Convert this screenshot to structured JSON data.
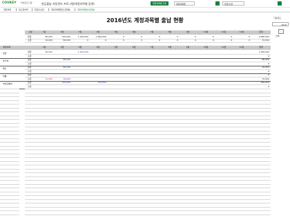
{
  "app": {
    "logo": "COUKEY",
    "logo_sub": "엑셀프로그램",
    "title": "현금출납 자동관리 프로그램(계정과목별 집계)",
    "green_button": "계정과목별 조회",
    "select_label": "계정과목명",
    "input_value": "입금/출금",
    "accent": "#1d7f3a"
  },
  "tabs": [
    {
      "label": "계정과목"
    },
    {
      "label": "입출금내역"
    },
    {
      "label": "현금출납장"
    },
    {
      "label": "계정과목별입출금현황"
    },
    {
      "label": "계정과목별출납현황"
    }
  ],
  "sidebar": {
    "label": "기준년도",
    "year": "2016",
    "icon_label": "인쇄"
  },
  "report": {
    "title": "2016년도 계정과목별 출납 현황",
    "month_header": "구분",
    "months": [
      "1월",
      "2월",
      "3월",
      "4월",
      "5월",
      "6월",
      "7월",
      "8월",
      "9월",
      "10월",
      "11월",
      "12월",
      "합계"
    ],
    "summary_rows": [
      {
        "label": "입금",
        "values": [
          "80,000",
          "150,000",
          "1,100,000",
          "1,900,000",
          "0",
          "0",
          "0",
          "0",
          "0",
          "0",
          "0",
          "0",
          "4,980,000"
        ]
      },
      {
        "label": "출금",
        "values": [
          "10,000",
          "80,000",
          "0",
          "0",
          "0",
          "0",
          "0",
          "0",
          "0",
          "0",
          "0",
          "0",
          "70,000"
        ]
      }
    ],
    "account_header": "계정과목",
    "accounts": [
      {
        "name": "입금",
        "in": [
          "80,000",
          "",
          "1,100,000",
          "",
          "",
          "",
          "",
          "",
          "",
          "",
          "",
          "",
          "1,000,000"
        ],
        "out": [
          "",
          "",
          "",
          "",
          "",
          "",
          "",
          "",
          "",
          "",
          "",
          "",
          "0"
        ]
      },
      {
        "name": "부가세",
        "in": [
          "",
          "80,000",
          "",
          "",
          "",
          "",
          "",
          "",
          "",
          "",
          "",
          "",
          "80,000"
        ],
        "out": [
          "",
          "",
          "",
          "",
          "",
          "",
          "",
          "",
          "",
          "",
          "",
          "",
          "0"
        ]
      },
      {
        "name": "매출",
        "in": [
          "",
          "80,000",
          "",
          "",
          "",
          "",
          "",
          "",
          "",
          "",
          "",
          "",
          "10,000"
        ],
        "out": [
          "",
          "",
          "",
          "",
          "",
          "",
          "",
          "",
          "",
          "",
          "",
          "",
          "0"
        ]
      },
      {
        "name": "비품",
        "in": [
          "",
          "",
          "",
          "",
          "",
          "",
          "",
          "",
          "",
          "",
          "",
          "",
          "0"
        ],
        "out": [
          "10,000",
          "30,000",
          "",
          "",
          "",
          "",
          "",
          "",
          "",
          "",
          "",
          "",
          "70,000"
        ]
      },
      {
        "name": "여비교통비",
        "in": [
          "",
          "150,000",
          "",
          "100,000",
          "",
          "",
          "",
          "",
          "",
          "",
          "",
          "",
          "200,000"
        ],
        "out": [
          "",
          "",
          "",
          "",
          "",
          "",
          "",
          "",
          "",
          "",
          "",
          "",
          "0"
        ]
      }
    ],
    "in_label": "입금",
    "out_label": "출금"
  }
}
